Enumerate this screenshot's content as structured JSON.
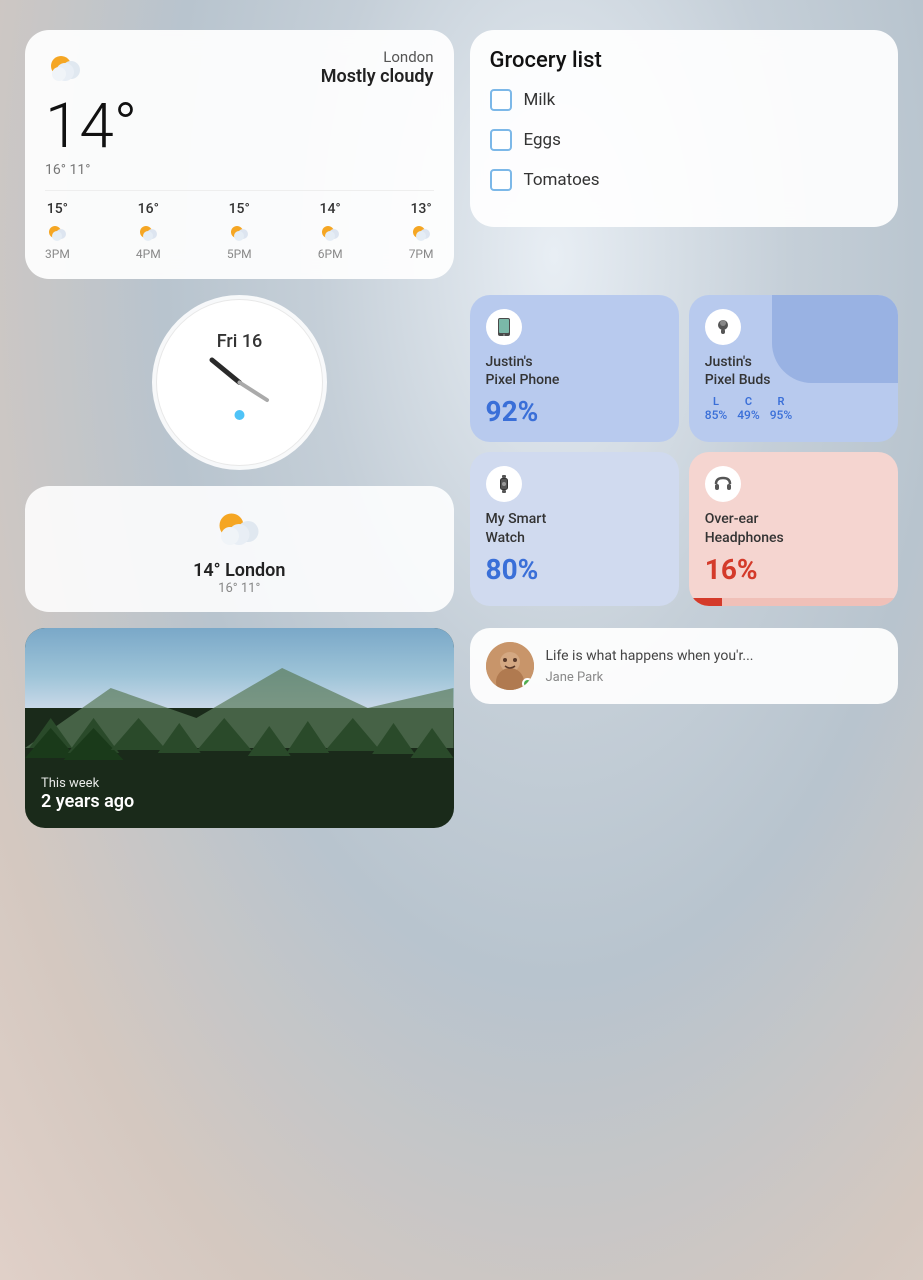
{
  "weather": {
    "location": "London",
    "condition": "Mostly cloudy",
    "temp": "14°",
    "hi": "16°",
    "lo": "11°",
    "forecast": [
      {
        "time": "3PM",
        "temp": "15°"
      },
      {
        "time": "4PM",
        "temp": "16°"
      },
      {
        "time": "5PM",
        "temp": "15°"
      },
      {
        "time": "6PM",
        "temp": "14°"
      },
      {
        "time": "7PM",
        "temp": "13°"
      }
    ]
  },
  "grocery": {
    "title": "Grocery list",
    "items": [
      "Milk",
      "Eggs",
      "Tomatoes"
    ]
  },
  "clock": {
    "day": "Fri 16"
  },
  "devices": [
    {
      "name": "Justin's\nPixel Phone",
      "battery": "92%",
      "type": "phone",
      "low": false
    },
    {
      "name": "Justin's\nPixel Buds",
      "battery": "",
      "type": "buds",
      "low": false,
      "levels": {
        "l": "85%",
        "c": "49%",
        "r": "95%"
      }
    },
    {
      "name": "My Smart\nWatch",
      "battery": "80%",
      "type": "watch",
      "low": false
    },
    {
      "name": "Over-ear\nHeadphones",
      "battery": "16%",
      "type": "headphones",
      "low": true
    }
  ],
  "weather_small": {
    "temp": "14° London",
    "hi": "16°",
    "lo": "11°"
  },
  "memory": {
    "sub": "This week",
    "main": "2 years ago"
  },
  "message": {
    "text": "Life is what happens when you'r...",
    "sender": "Jane Park"
  }
}
